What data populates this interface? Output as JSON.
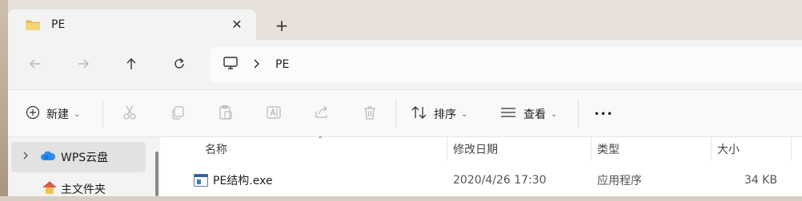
{
  "tab": {
    "title": "PE",
    "close_glyph": "✕",
    "new_tab_glyph": "+"
  },
  "address": {
    "location": "PE"
  },
  "toolbar": {
    "new_label": "新建",
    "sort_label": "排序",
    "view_label": "查看",
    "more_glyph": "•••"
  },
  "sidebar": {
    "items": [
      {
        "label": "WPS云盘"
      },
      {
        "label": "主文件夹"
      }
    ]
  },
  "columns": {
    "name": "名称",
    "modified": "修改日期",
    "type": "类型",
    "size": "大小"
  },
  "files": [
    {
      "name": "PE结构.exe",
      "modified": "2020/4/26 17:30",
      "type": "应用程序",
      "size": "34 KB"
    }
  ],
  "colors": {
    "accent": "#0067c0",
    "folder": "#f2c14e"
  }
}
